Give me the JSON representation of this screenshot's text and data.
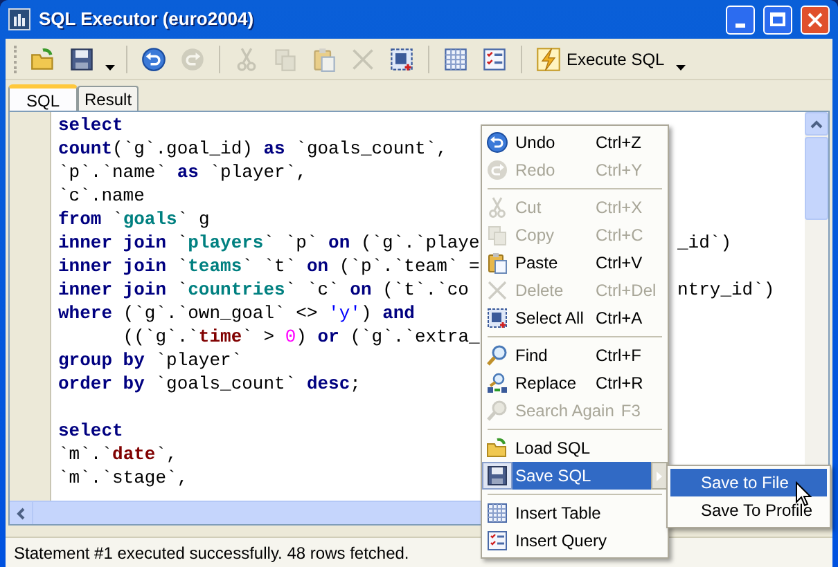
{
  "window": {
    "title": "SQL Executor (euro2004)"
  },
  "toolbar": [
    {
      "kind": "button",
      "disabled": false
    },
    {
      "kind": "button",
      "disabled": false
    },
    {
      "kind": "dropdown"
    },
    {
      "kind": "separator"
    },
    {
      "kind": "button",
      "disabled": false
    },
    {
      "kind": "button",
      "disabled": true
    },
    {
      "kind": "separator"
    },
    {
      "kind": "button",
      "disabled": true
    },
    {
      "kind": "button",
      "disabled": true
    },
    {
      "kind": "button",
      "disabled": true
    },
    {
      "kind": "button",
      "disabled": true
    },
    {
      "kind": "button",
      "disabled": false
    },
    {
      "kind": "separator"
    },
    {
      "kind": "button",
      "disabled": false
    },
    {
      "kind": "button",
      "disabled": false
    },
    {
      "kind": "separator"
    },
    {
      "kind": "text",
      "label": "Execute SQL",
      "disabled": false
    },
    {
      "kind": "dropdown"
    }
  ],
  "tabs": [
    {
      "label": "SQL",
      "selected": true
    },
    {
      "label": "Result",
      "selected": false
    }
  ],
  "editor": {
    "lines": [
      {
        "kind": "code",
        "left": [
          {
            "kind": "keyword",
            "text": "select"
          }
        ]
      },
      {
        "kind": "code",
        "left": [
          {
            "kind": "keyword",
            "text": "count"
          },
          {
            "kind": "plain",
            "text": "(`g`.goal_id) "
          },
          {
            "kind": "keyword",
            "text": "as"
          },
          {
            "kind": "plain",
            "text": " `goals_count`,"
          }
        ]
      },
      {
        "kind": "code",
        "left": [
          {
            "kind": "plain",
            "text": "`p`.`name` "
          },
          {
            "kind": "keyword",
            "text": "as"
          },
          {
            "kind": "plain",
            "text": " `player`,"
          }
        ]
      },
      {
        "kind": "code",
        "left": [
          {
            "kind": "plain",
            "text": "`c`.name"
          }
        ]
      },
      {
        "kind": "code",
        "left": [
          {
            "kind": "keyword",
            "text": "from"
          },
          {
            "kind": "plain",
            "text": " `"
          },
          {
            "kind": "table",
            "text": "goals"
          },
          {
            "kind": "plain",
            "text": "` g"
          }
        ]
      },
      {
        "kind": "code",
        "left": [
          {
            "kind": "keyword",
            "text": "inner join"
          },
          {
            "kind": "plain",
            "text": " `"
          },
          {
            "kind": "table",
            "text": "players"
          },
          {
            "kind": "plain",
            "text": "` `p` "
          },
          {
            "kind": "keyword",
            "text": "on"
          },
          {
            "kind": "plain",
            "text": " (`g`.`playe"
          }
        ],
        "right": "_id`)"
      },
      {
        "kind": "code",
        "left": [
          {
            "kind": "keyword",
            "text": "inner join"
          },
          {
            "kind": "plain",
            "text": " `"
          },
          {
            "kind": "table",
            "text": "teams"
          },
          {
            "kind": "plain",
            "text": "` `t` "
          },
          {
            "kind": "keyword",
            "text": "on"
          },
          {
            "kind": "plain",
            "text": " (`p`.`team` ="
          }
        ]
      },
      {
        "kind": "code",
        "left": [
          {
            "kind": "keyword",
            "text": "inner join"
          },
          {
            "kind": "plain",
            "text": " `"
          },
          {
            "kind": "table",
            "text": "countries"
          },
          {
            "kind": "plain",
            "text": "` `c` "
          },
          {
            "kind": "keyword",
            "text": "on"
          },
          {
            "kind": "plain",
            "text": " (`t`.`co"
          }
        ],
        "right": "ntry_id`)"
      },
      {
        "kind": "code",
        "left": [
          {
            "kind": "keyword",
            "text": "where"
          },
          {
            "kind": "plain",
            "text": " (`g`.`own_goal` <> "
          },
          {
            "kind": "string",
            "text": "'y'"
          },
          {
            "kind": "plain",
            "text": ") "
          },
          {
            "kind": "keyword",
            "text": "and"
          }
        ]
      },
      {
        "kind": "code",
        "left": [
          {
            "kind": "plain",
            "text": "      ((`g`.`"
          },
          {
            "kind": "reserved",
            "text": "time"
          },
          {
            "kind": "plain",
            "text": "` > "
          },
          {
            "kind": "number",
            "text": "0"
          },
          {
            "kind": "plain",
            "text": ") "
          },
          {
            "kind": "keyword",
            "text": "or"
          },
          {
            "kind": "plain",
            "text": " (`g`.`extra_"
          }
        ]
      },
      {
        "kind": "code",
        "left": [
          {
            "kind": "keyword",
            "text": "group by"
          },
          {
            "kind": "plain",
            "text": " `player`"
          }
        ]
      },
      {
        "kind": "code",
        "left": [
          {
            "kind": "keyword",
            "text": "order by"
          },
          {
            "kind": "plain",
            "text": " `goals_count` "
          },
          {
            "kind": "keyword",
            "text": "desc"
          },
          {
            "kind": "plain",
            "text": ";"
          }
        ]
      },
      {
        "kind": "blank"
      },
      {
        "kind": "code",
        "left": [
          {
            "kind": "keyword",
            "text": "select"
          }
        ]
      },
      {
        "kind": "code",
        "left": [
          {
            "kind": "plain",
            "text": "`m`.`"
          },
          {
            "kind": "reserved",
            "text": "date"
          },
          {
            "kind": "plain",
            "text": "`,"
          }
        ]
      },
      {
        "kind": "code",
        "left": [
          {
            "kind": "plain",
            "text": "`m`.`stage`,"
          }
        ]
      }
    ]
  },
  "context_menu": {
    "items": [
      {
        "kind": "item",
        "label": "Undo",
        "shortcut": "Ctrl+Z",
        "disabled": false,
        "selected": false
      },
      {
        "kind": "item",
        "label": "Redo",
        "shortcut": "Ctrl+Y",
        "disabled": true,
        "selected": false
      },
      {
        "kind": "separator"
      },
      {
        "kind": "item",
        "label": "Cut",
        "shortcut": "Ctrl+X",
        "disabled": true,
        "selected": false
      },
      {
        "kind": "item",
        "label": "Copy",
        "shortcut": "Ctrl+C",
        "disabled": true,
        "selected": false
      },
      {
        "kind": "item",
        "label": "Paste",
        "shortcut": "Ctrl+V",
        "disabled": false,
        "selected": false
      },
      {
        "kind": "item",
        "label": "Delete",
        "shortcut": "Ctrl+Del",
        "disabled": true,
        "selected": false
      },
      {
        "kind": "item",
        "label": "Select All",
        "shortcut": "Ctrl+A",
        "disabled": false,
        "selected": false
      },
      {
        "kind": "separator"
      },
      {
        "kind": "item",
        "label": "Find",
        "shortcut": "Ctrl+F",
        "disabled": false,
        "selected": false
      },
      {
        "kind": "item",
        "label": "Replace",
        "shortcut": "Ctrl+R",
        "disabled": false,
        "selected": false
      },
      {
        "kind": "item",
        "label": "Search Again",
        "shortcut": "F3",
        "disabled": true,
        "selected": false
      },
      {
        "kind": "separator"
      },
      {
        "kind": "item",
        "label": "Load SQL",
        "disabled": false,
        "selected": false
      },
      {
        "kind": "submenu",
        "label": "Save SQL",
        "disabled": false,
        "selected": true
      },
      {
        "kind": "separator"
      },
      {
        "kind": "item",
        "label": "Insert Table",
        "disabled": false,
        "selected": false
      },
      {
        "kind": "item",
        "label": "Insert Query",
        "disabled": false,
        "selected": false
      }
    ]
  },
  "submenu": {
    "items": [
      {
        "label": "Save to File",
        "selected": true
      },
      {
        "label": "Save To Profile",
        "selected": false
      }
    ]
  },
  "status_bar": {
    "text": "Statement #1 executed successfully. 48 rows fetched."
  }
}
